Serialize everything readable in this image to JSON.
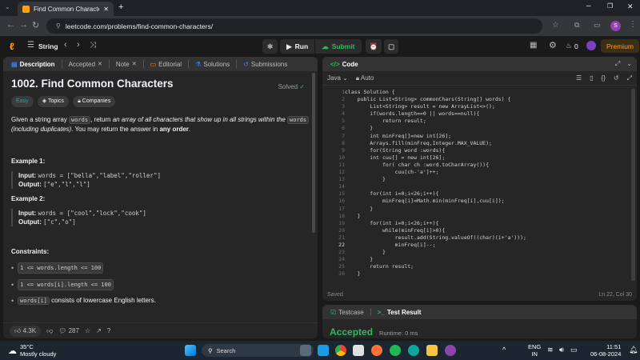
{
  "browser": {
    "tab_title": "Find Common Characters - Lee",
    "url": "leetcode.com/problems/find-common-characters/"
  },
  "header": {
    "list_name": "String",
    "run_label": "Run",
    "submit_label": "Submit",
    "coins": "0",
    "premium_label": "Premium"
  },
  "left_tabs": [
    "Description",
    "Accepted",
    "Note",
    "Editorial",
    "Solutions",
    "Submissions"
  ],
  "problem": {
    "title": "1002. Find Common Characters",
    "status": "Solved",
    "difficulty": "Easy",
    "topics_label": "Topics",
    "companies_label": "Companies",
    "desc_1": "Given a string array ",
    "desc_words": "words",
    "desc_2": ", return ",
    "desc_3": "an array of all characters that show up in all strings within the ",
    "desc_words2": "words",
    "desc_4": " (including duplicates)",
    "desc_5": ". You may return the answer in ",
    "desc_6": "any order",
    "desc_7": ".",
    "example1_title": "Example 1:",
    "example1_input_label": "Input:",
    "example1_input": "words = [\"bella\",\"label\",\"roller\"]",
    "example1_output_label": "Output:",
    "example1_output": "[\"e\",\"l\",\"l\"]",
    "example2_title": "Example 2:",
    "example2_input_label": "Input:",
    "example2_input": "words = [\"cool\",\"lock\",\"cook\"]",
    "example2_output_label": "Output:",
    "example2_output": "[\"c\",\"o\"]",
    "constraints_title": "Constraints:",
    "c1": "1 <= words.length <= 100",
    "c2": "1 <= words[i].length <= 100",
    "c3_code": "words[i]",
    "c3_text": " consists of lowercase English letters.",
    "likes": "4.3K",
    "comments": "287"
  },
  "code": {
    "panel_title": "Code",
    "language": "Java",
    "auto": "Auto",
    "line_numbers": [
      "1",
      "2",
      "3",
      "4",
      "5",
      "6",
      "7",
      "8",
      "9",
      "10",
      "11",
      "12",
      "13",
      "14",
      "15",
      "16",
      "17",
      "18",
      "19",
      "20",
      "21",
      "22",
      "23",
      "24",
      "25",
      "26"
    ],
    "source": [
      "class Solution {",
      "    public List<String> commonChars(String[] words) {",
      "        List<String> result = new ArrayList<>();",
      "        if(words.length==0 || words==null){",
      "            return result;",
      "        }",
      "        int minFreq[]=new int[26];",
      "        Arrays.fill(minFreq,Integer.MAX_VALUE);",
      "        for(String word :words){",
      "        int cuu[] = new int[26];",
      "            for( char ch :word.toCharArray()){",
      "                cuu[ch-'a']++;",
      "            }",
      "",
      "        for(int i=0;i<26;i++){",
      "            minFreq[i]=Math.min(minFreq[i],cuu[i]);",
      "        }",
      "    }",
      "        for(int i=0;i<26;i++){",
      "            while(minFreq[i]>0){",
      "                result.add(String.valueOf((char)(i+'a')));",
      "                minFreq[i]--;",
      "            }",
      "        }",
      "        return result;",
      "    }"
    ],
    "saved": "Saved",
    "cursor": "Ln 22, Col 30"
  },
  "test": {
    "tab1": "Testcase",
    "tab2": "Test Result",
    "status": "Accepted",
    "runtime": "Runtime: 0 ms"
  },
  "taskbar": {
    "temp": "35°C",
    "weather": "Mostly cloudy",
    "search_placeholder": "Search",
    "lang1": "ENG",
    "lang2": "IN",
    "time": "11:51",
    "date": "06-08-2024"
  }
}
